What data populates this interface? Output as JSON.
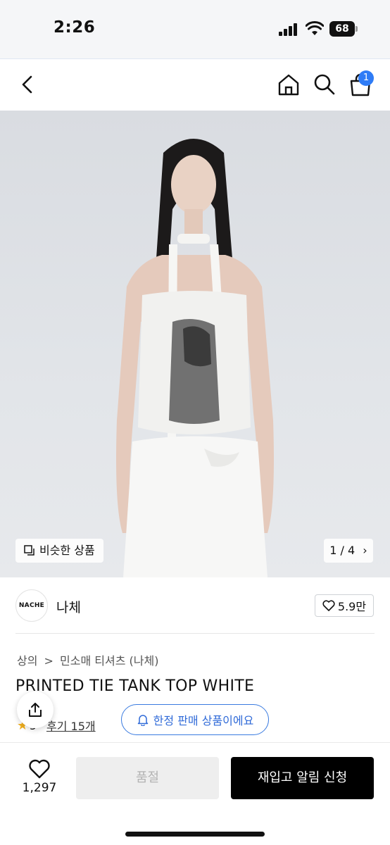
{
  "status_bar": {
    "time": "2:26",
    "battery": "68"
  },
  "header": {
    "cart_count": "1"
  },
  "gallery": {
    "similar_label": "비슷한 상품",
    "pager": "1 / 4",
    "pager_arrow": "›"
  },
  "brand": {
    "logo_text": "NACHE",
    "name": "나체",
    "likes": "5.9만"
  },
  "breadcrumb": {
    "category": "상의",
    "separator": ">",
    "subcategory": "민소매 티셔츠 (나체)"
  },
  "product": {
    "title": "PRINTED TIE TANK TOP WHITE",
    "rating": "5",
    "review_label": "후기 15개",
    "limited_label": "한정 판매 상품이에요"
  },
  "bottom_bar": {
    "wish_count": "1,297",
    "soldout_label": "품절",
    "restock_label": "재입고 알림 신청"
  },
  "colors": {
    "accent_blue": "#2f7cf6",
    "star": "#f2b01e",
    "cta": "#000000"
  }
}
